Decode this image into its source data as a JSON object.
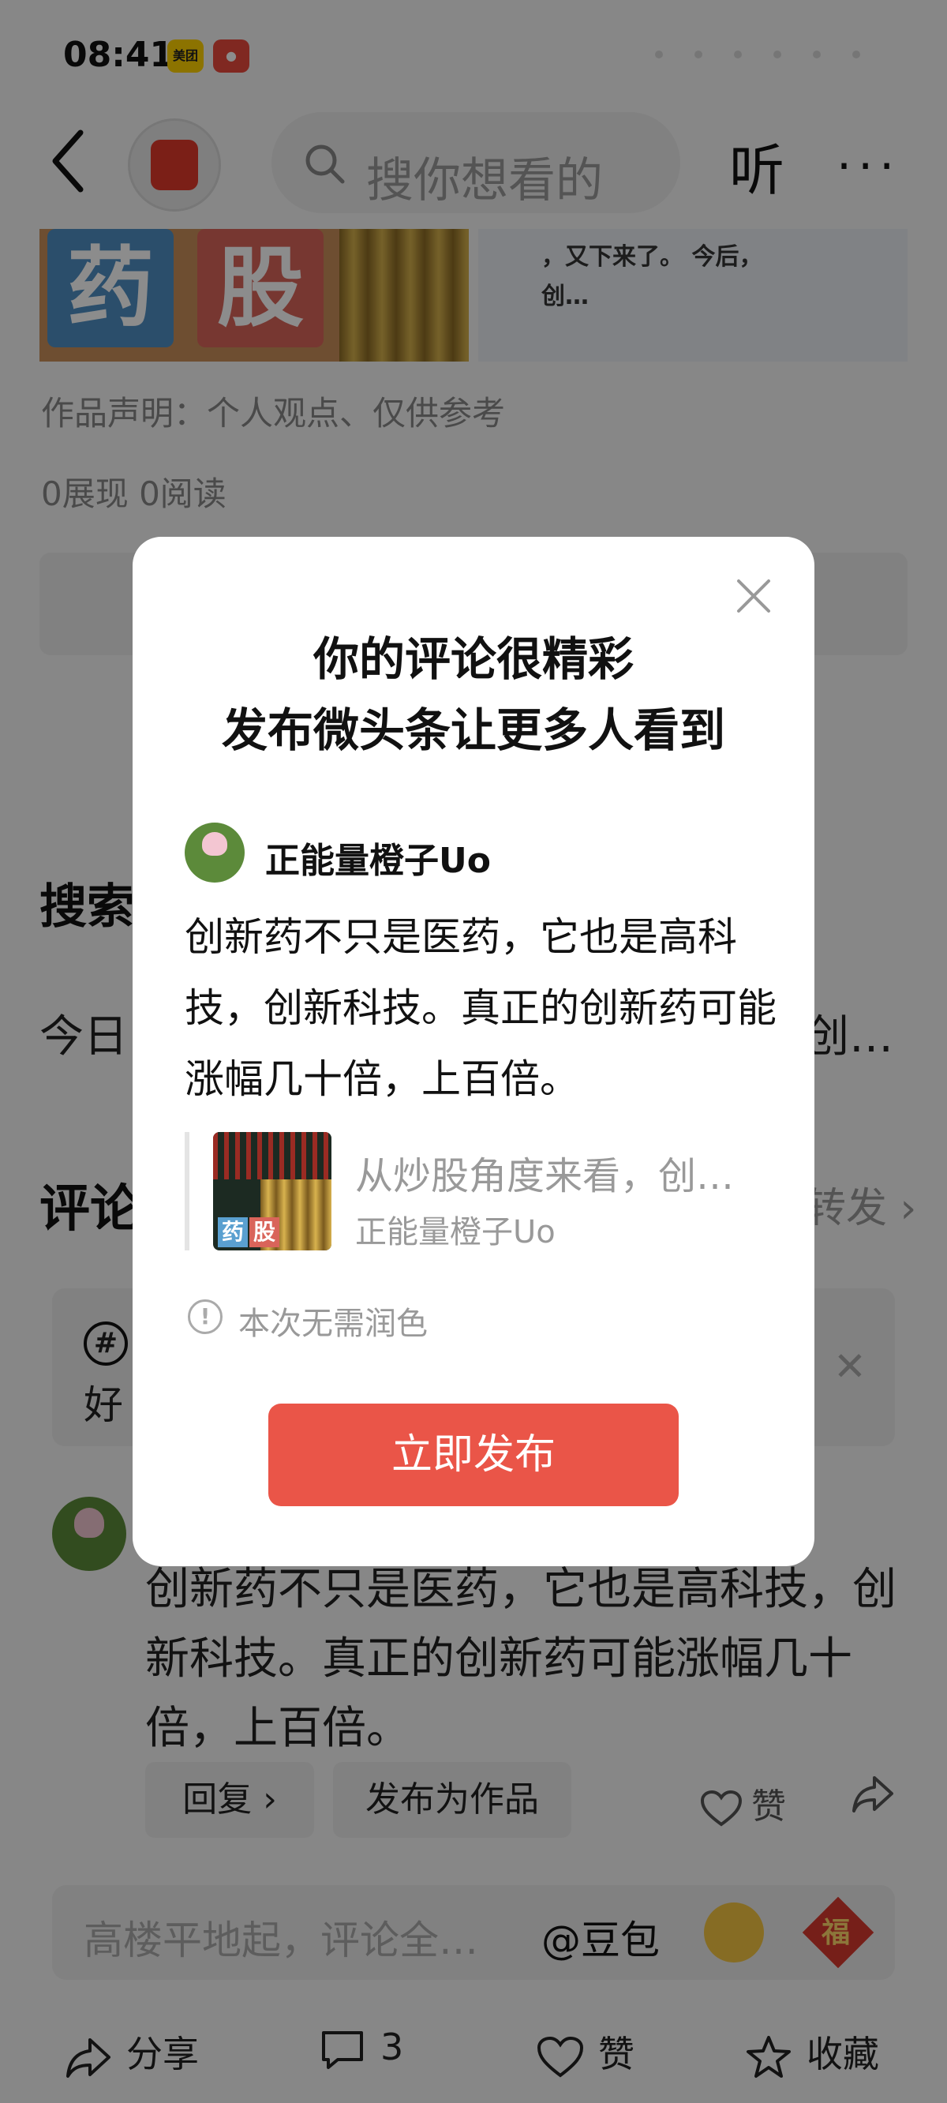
{
  "status_bar": {
    "time": "08:41",
    "badges": [
      "美团"
    ]
  },
  "header": {
    "search_placeholder": "搜你想看的",
    "listen_label": "听",
    "more_label": "···"
  },
  "article": {
    "thumb_left_chars": [
      "药",
      "股"
    ],
    "thumb_right_line1": "，又下来了。    今后，",
    "thumb_right_line2": "创…",
    "declaration": "作品声明：个人观点、仅供参考",
    "stats": "0展现  0阅读"
  },
  "search_section": {
    "title": "搜索",
    "today_line": "今日",
    "today_tail": "创…"
  },
  "comments": {
    "title": "评论",
    "forward_label": "转发 ›",
    "topic_text": "好",
    "comment_text": "创新药不只是医药，它也是高科技，创新科技。真正的创新药可能涨幅几十倍，上百倍。",
    "reply_label": "回复 ›",
    "publish_work_label": "发布为作品",
    "like_label": "赞"
  },
  "comment_input": {
    "placeholder": "高楼平地起，评论全…",
    "mention": "@豆包",
    "fu_char": "福"
  },
  "bottom_bar": {
    "share_label": "分享",
    "comment_count": "3",
    "like_label": "赞",
    "collect_label": "收藏"
  },
  "dialog": {
    "title_line1": "你的评论很精彩",
    "title_line2": "发布微头条让更多人看到",
    "username": "正能量橙子Uo",
    "body": "创新药不只是医药，它也是高科技，创新科技。真正的创新药可能涨幅几十倍，上百倍。",
    "quote_title": "从炒股角度来看，创…",
    "quote_author": "正能量橙子Uo",
    "quote_thumb_chars": [
      "药",
      "股"
    ],
    "hint": "本次无需润色",
    "publish_button": "立即发布"
  },
  "colors": {
    "accent_red": "#ea5548",
    "overlay": "rgba(0,0,0,0.45)"
  }
}
